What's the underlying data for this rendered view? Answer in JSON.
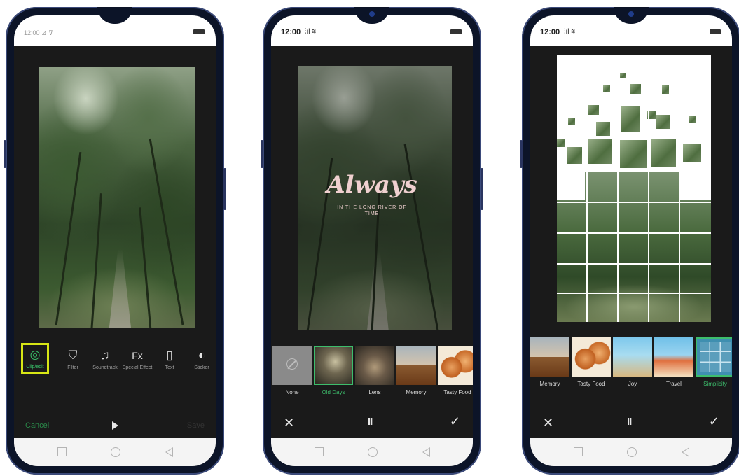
{
  "phone1": {
    "status_time": "12:00 ⊿ ⊽",
    "tools": [
      {
        "label": "Clip/edit",
        "icon": "clip-icon"
      },
      {
        "label": "Filter",
        "icon": "filter-icon"
      },
      {
        "label": "Soundtrack",
        "icon": "music-icon"
      },
      {
        "label": "Special Effect",
        "icon": "fx-icon"
      },
      {
        "label": "Text",
        "icon": "text-icon"
      },
      {
        "label": "Sticker",
        "icon": "sticker-icon"
      }
    ],
    "cancel_label": "Cancel",
    "save_label": "Save"
  },
  "phone2": {
    "status_time": "12:00",
    "title": "Always",
    "subtitle": "IN THE LONG RIVER OF TIME",
    "themes": [
      "None",
      "Old Days",
      "Lens",
      "Memory",
      "Tasty Food"
    ],
    "selected_theme": "Old Days"
  },
  "phone3": {
    "status_time": "12:00",
    "themes": [
      "Memory",
      "Tasty Food",
      "Joy",
      "Travel",
      "Simplicity"
    ],
    "selected_theme": "Simplicity"
  },
  "colors": {
    "accent": "#3dbd6c",
    "highlight_box": "#d7e615",
    "frame": "#0c1428"
  },
  "icons": {
    "close": "✕",
    "pause": "II",
    "confirm": "✓",
    "play": "play-icon"
  }
}
